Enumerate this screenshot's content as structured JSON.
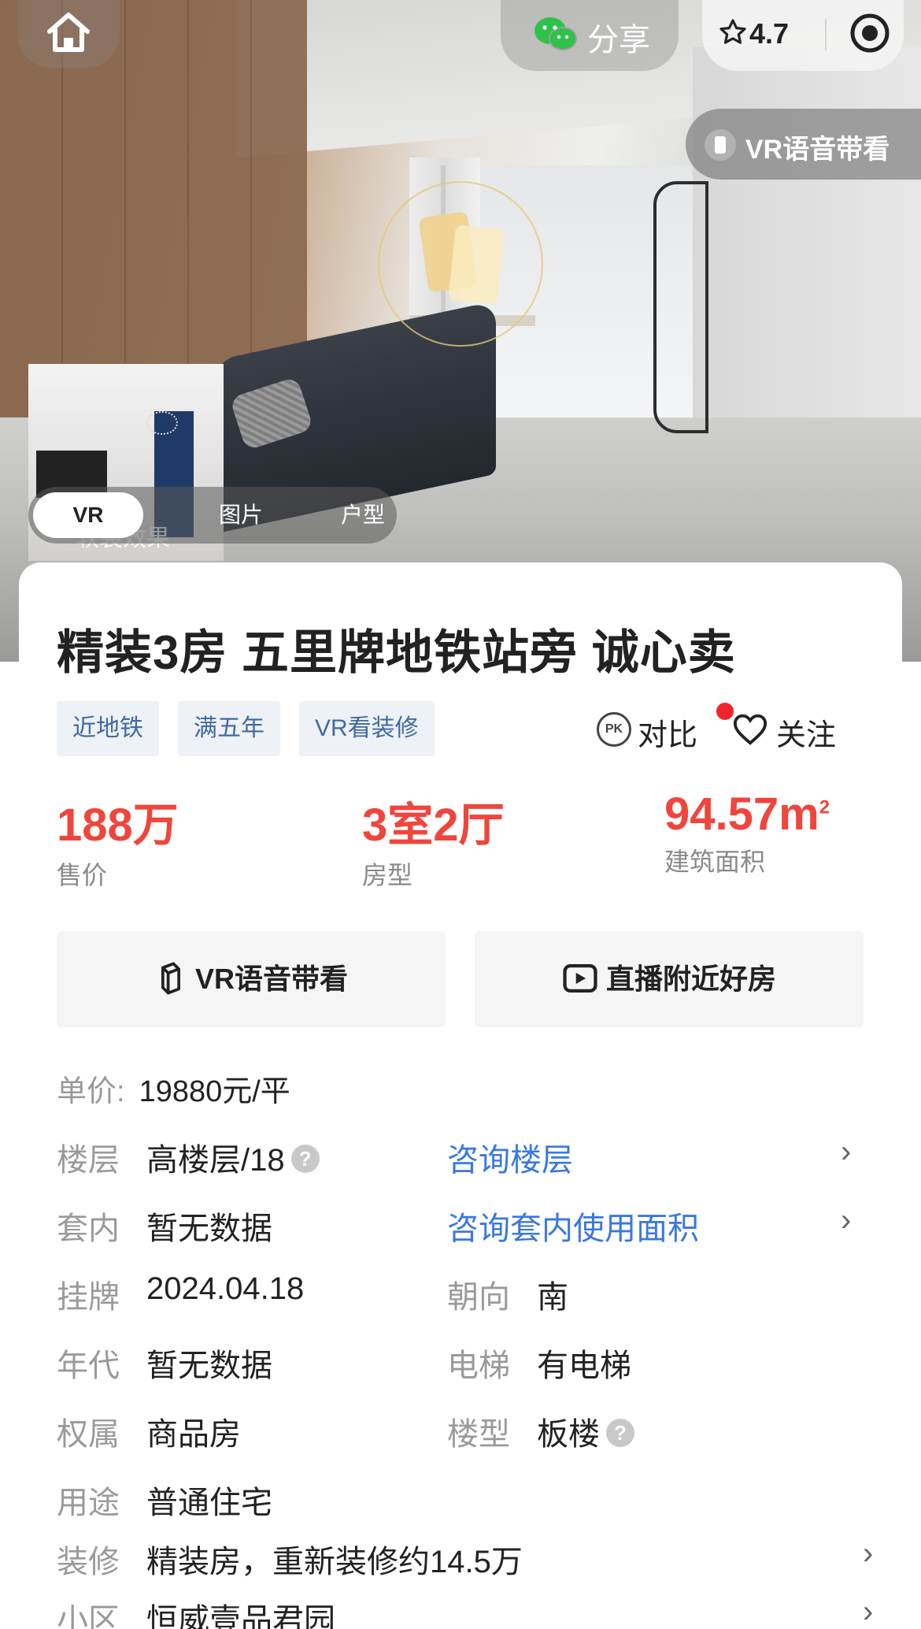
{
  "hero": {
    "share_label": "分享",
    "rating": "4.7",
    "vr_voice_chip": "VR语音带看",
    "thumb_caption": "软装效果",
    "media_tabs": [
      "VR",
      "图片",
      "户型"
    ]
  },
  "listing": {
    "title": "精装3房 五里牌地铁站旁 诚心卖",
    "tags": [
      "近地铁",
      "满五年",
      "VR看装修"
    ],
    "compare_label": "对比",
    "compare_badge": "PK",
    "follow_label": "关注",
    "stats": [
      {
        "value": "188万",
        "label": "售价"
      },
      {
        "value": "3室2厅",
        "label": "房型"
      },
      {
        "value": "94.57m",
        "sup": "2",
        "label": "建筑面积"
      }
    ],
    "buttons": {
      "vr": "VR语音带看",
      "live": "直播附近好房"
    },
    "unit_price": {
      "label": "单价:",
      "value": "19880元/平"
    },
    "details": {
      "floor": {
        "k": "楼层",
        "v": "高楼层/18",
        "link": "咨询楼层"
      },
      "inner": {
        "k": "套内",
        "v": "暂无数据",
        "link": "咨询套内使用面积"
      },
      "listed": {
        "k": "挂牌",
        "v": "2024.04.18",
        "k2": "朝向",
        "v2": "南"
      },
      "year": {
        "k": "年代",
        "v": "暂无数据",
        "k2": "电梯",
        "v2": "有电梯"
      },
      "ownership": {
        "k": "权属",
        "v": "商品房",
        "k2": "楼型",
        "v2": "板楼"
      },
      "usage": {
        "k": "用途",
        "v": "普通住宅"
      },
      "decor": {
        "k": "装修",
        "v": "精装房，重新装修约14.5万"
      },
      "community": {
        "k": "小区",
        "v": "恒威壹品君园"
      }
    }
  },
  "icons": {
    "home": "home-icon",
    "share": "wechat-icon",
    "star": "star-icon",
    "target": "target-icon",
    "vr": "vr-cube-icon",
    "live": "play-icon",
    "heart": "heart-icon",
    "chevron": "chevron-right-icon",
    "help": "question-icon"
  },
  "colors": {
    "price_red": "#f0453c",
    "link_blue": "#3a78e0",
    "tag_blue": "#3f6aa5",
    "tag_bg": "#eef1f5",
    "badge_red": "#f1262b"
  }
}
